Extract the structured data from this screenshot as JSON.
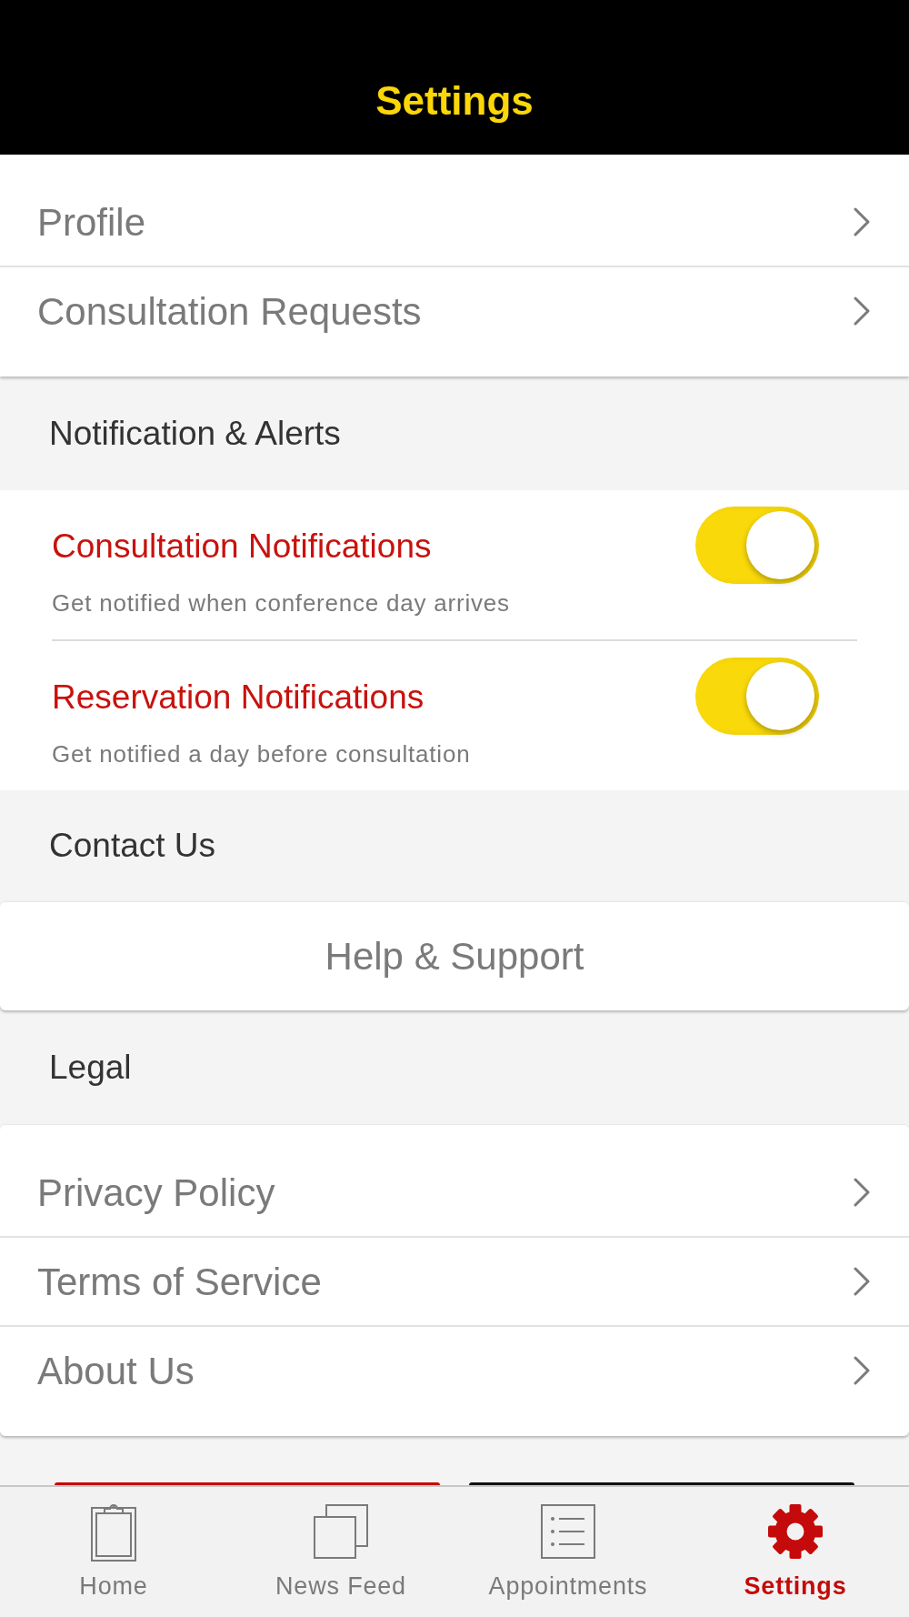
{
  "header": {
    "title": "Settings"
  },
  "account_menu": [
    {
      "label": "Profile"
    },
    {
      "label": "Consultation Requests"
    }
  ],
  "notifications": {
    "heading": "Notification & Alerts",
    "items": [
      {
        "title": "Consultation Notifications",
        "description": "Get notified when conference day arrives",
        "on": true
      },
      {
        "title": "Reservation Notifications",
        "description": "Get notified a day before consultation",
        "on": true
      }
    ]
  },
  "contact": {
    "heading": "Contact Us",
    "button": "Help & Support"
  },
  "legal": {
    "heading": "Legal",
    "items": [
      {
        "label": "Privacy Policy"
      },
      {
        "label": "Terms of Service"
      },
      {
        "label": "About Us"
      }
    ]
  },
  "bottom_buttons": [
    {
      "kind": "primary"
    },
    {
      "kind": "dark"
    }
  ],
  "tab_bar": [
    {
      "label": "Home",
      "selected": false
    },
    {
      "label": "News Feed",
      "selected": false
    },
    {
      "label": "Appointments",
      "selected": false
    },
    {
      "label": "Settings",
      "selected": true
    }
  ]
}
